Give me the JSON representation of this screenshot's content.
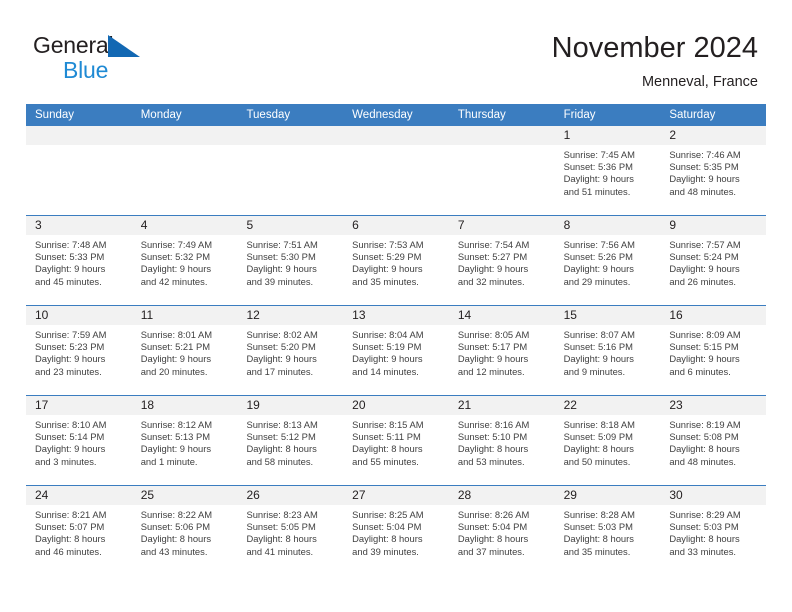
{
  "brand": {
    "word1": "General",
    "word2": "Blue",
    "triangle_color": "#1268b3",
    "blue_color": "#1f8ad4"
  },
  "header": {
    "title": "November 2024",
    "location": "Menneval, France"
  },
  "calendar": {
    "header_bg": "#3b7dc0",
    "daynum_bg": "#f2f2f2",
    "weekdays": [
      "Sunday",
      "Monday",
      "Tuesday",
      "Wednesday",
      "Thursday",
      "Friday",
      "Saturday"
    ],
    "weeks": [
      [
        {
          "empty": true
        },
        {
          "empty": true
        },
        {
          "empty": true
        },
        {
          "empty": true
        },
        {
          "empty": true
        },
        {
          "day": "1",
          "sunrise": "Sunrise: 7:45 AM",
          "sunset": "Sunset: 5:36 PM",
          "daylight1": "Daylight: 9 hours",
          "daylight2": "and 51 minutes."
        },
        {
          "day": "2",
          "sunrise": "Sunrise: 7:46 AM",
          "sunset": "Sunset: 5:35 PM",
          "daylight1": "Daylight: 9 hours",
          "daylight2": "and 48 minutes."
        }
      ],
      [
        {
          "day": "3",
          "sunrise": "Sunrise: 7:48 AM",
          "sunset": "Sunset: 5:33 PM",
          "daylight1": "Daylight: 9 hours",
          "daylight2": "and 45 minutes."
        },
        {
          "day": "4",
          "sunrise": "Sunrise: 7:49 AM",
          "sunset": "Sunset: 5:32 PM",
          "daylight1": "Daylight: 9 hours",
          "daylight2": "and 42 minutes."
        },
        {
          "day": "5",
          "sunrise": "Sunrise: 7:51 AM",
          "sunset": "Sunset: 5:30 PM",
          "daylight1": "Daylight: 9 hours",
          "daylight2": "and 39 minutes."
        },
        {
          "day": "6",
          "sunrise": "Sunrise: 7:53 AM",
          "sunset": "Sunset: 5:29 PM",
          "daylight1": "Daylight: 9 hours",
          "daylight2": "and 35 minutes."
        },
        {
          "day": "7",
          "sunrise": "Sunrise: 7:54 AM",
          "sunset": "Sunset: 5:27 PM",
          "daylight1": "Daylight: 9 hours",
          "daylight2": "and 32 minutes."
        },
        {
          "day": "8",
          "sunrise": "Sunrise: 7:56 AM",
          "sunset": "Sunset: 5:26 PM",
          "daylight1": "Daylight: 9 hours",
          "daylight2": "and 29 minutes."
        },
        {
          "day": "9",
          "sunrise": "Sunrise: 7:57 AM",
          "sunset": "Sunset: 5:24 PM",
          "daylight1": "Daylight: 9 hours",
          "daylight2": "and 26 minutes."
        }
      ],
      [
        {
          "day": "10",
          "sunrise": "Sunrise: 7:59 AM",
          "sunset": "Sunset: 5:23 PM",
          "daylight1": "Daylight: 9 hours",
          "daylight2": "and 23 minutes."
        },
        {
          "day": "11",
          "sunrise": "Sunrise: 8:01 AM",
          "sunset": "Sunset: 5:21 PM",
          "daylight1": "Daylight: 9 hours",
          "daylight2": "and 20 minutes."
        },
        {
          "day": "12",
          "sunrise": "Sunrise: 8:02 AM",
          "sunset": "Sunset: 5:20 PM",
          "daylight1": "Daylight: 9 hours",
          "daylight2": "and 17 minutes."
        },
        {
          "day": "13",
          "sunrise": "Sunrise: 8:04 AM",
          "sunset": "Sunset: 5:19 PM",
          "daylight1": "Daylight: 9 hours",
          "daylight2": "and 14 minutes."
        },
        {
          "day": "14",
          "sunrise": "Sunrise: 8:05 AM",
          "sunset": "Sunset: 5:17 PM",
          "daylight1": "Daylight: 9 hours",
          "daylight2": "and 12 minutes."
        },
        {
          "day": "15",
          "sunrise": "Sunrise: 8:07 AM",
          "sunset": "Sunset: 5:16 PM",
          "daylight1": "Daylight: 9 hours",
          "daylight2": "and 9 minutes."
        },
        {
          "day": "16",
          "sunrise": "Sunrise: 8:09 AM",
          "sunset": "Sunset: 5:15 PM",
          "daylight1": "Daylight: 9 hours",
          "daylight2": "and 6 minutes."
        }
      ],
      [
        {
          "day": "17",
          "sunrise": "Sunrise: 8:10 AM",
          "sunset": "Sunset: 5:14 PM",
          "daylight1": "Daylight: 9 hours",
          "daylight2": "and 3 minutes."
        },
        {
          "day": "18",
          "sunrise": "Sunrise: 8:12 AM",
          "sunset": "Sunset: 5:13 PM",
          "daylight1": "Daylight: 9 hours",
          "daylight2": "and 1 minute."
        },
        {
          "day": "19",
          "sunrise": "Sunrise: 8:13 AM",
          "sunset": "Sunset: 5:12 PM",
          "daylight1": "Daylight: 8 hours",
          "daylight2": "and 58 minutes."
        },
        {
          "day": "20",
          "sunrise": "Sunrise: 8:15 AM",
          "sunset": "Sunset: 5:11 PM",
          "daylight1": "Daylight: 8 hours",
          "daylight2": "and 55 minutes."
        },
        {
          "day": "21",
          "sunrise": "Sunrise: 8:16 AM",
          "sunset": "Sunset: 5:10 PM",
          "daylight1": "Daylight: 8 hours",
          "daylight2": "and 53 minutes."
        },
        {
          "day": "22",
          "sunrise": "Sunrise: 8:18 AM",
          "sunset": "Sunset: 5:09 PM",
          "daylight1": "Daylight: 8 hours",
          "daylight2": "and 50 minutes."
        },
        {
          "day": "23",
          "sunrise": "Sunrise: 8:19 AM",
          "sunset": "Sunset: 5:08 PM",
          "daylight1": "Daylight: 8 hours",
          "daylight2": "and 48 minutes."
        }
      ],
      [
        {
          "day": "24",
          "sunrise": "Sunrise: 8:21 AM",
          "sunset": "Sunset: 5:07 PM",
          "daylight1": "Daylight: 8 hours",
          "daylight2": "and 46 minutes."
        },
        {
          "day": "25",
          "sunrise": "Sunrise: 8:22 AM",
          "sunset": "Sunset: 5:06 PM",
          "daylight1": "Daylight: 8 hours",
          "daylight2": "and 43 minutes."
        },
        {
          "day": "26",
          "sunrise": "Sunrise: 8:23 AM",
          "sunset": "Sunset: 5:05 PM",
          "daylight1": "Daylight: 8 hours",
          "daylight2": "and 41 minutes."
        },
        {
          "day": "27",
          "sunrise": "Sunrise: 8:25 AM",
          "sunset": "Sunset: 5:04 PM",
          "daylight1": "Daylight: 8 hours",
          "daylight2": "and 39 minutes."
        },
        {
          "day": "28",
          "sunrise": "Sunrise: 8:26 AM",
          "sunset": "Sunset: 5:04 PM",
          "daylight1": "Daylight: 8 hours",
          "daylight2": "and 37 minutes."
        },
        {
          "day": "29",
          "sunrise": "Sunrise: 8:28 AM",
          "sunset": "Sunset: 5:03 PM",
          "daylight1": "Daylight: 8 hours",
          "daylight2": "and 35 minutes."
        },
        {
          "day": "30",
          "sunrise": "Sunrise: 8:29 AM",
          "sunset": "Sunset: 5:03 PM",
          "daylight1": "Daylight: 8 hours",
          "daylight2": "and 33 minutes."
        }
      ]
    ]
  }
}
